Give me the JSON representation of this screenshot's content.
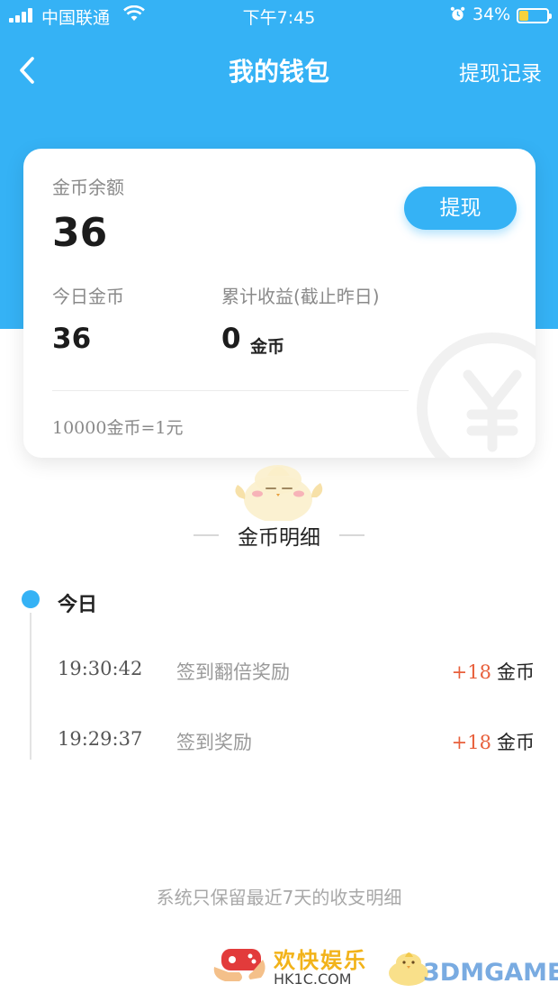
{
  "status_bar": {
    "carrier": "中国联通",
    "time": "下午7:45",
    "battery_percent": "34%",
    "battery_level": 0.34
  },
  "nav": {
    "title": "我的钱包",
    "right_link": "提现记录"
  },
  "balance_card": {
    "balance_label": "金币余额",
    "balance_value": "36",
    "withdraw_button": "提现",
    "today_label": "今日金币",
    "today_value": "36",
    "total_label": "累计收益(截止昨日)",
    "total_value": "0",
    "total_unit": "金币",
    "exchange_rate": "10000金币=1元"
  },
  "details": {
    "section_title": "金币明细",
    "day_label": "今日",
    "rows": [
      {
        "time": "19:30:42",
        "desc": "签到翻倍奖励",
        "amount": "+18",
        "unit": "金币"
      },
      {
        "time": "19:29:37",
        "desc": "签到奖励",
        "amount": "+18",
        "unit": "金币"
      }
    ],
    "footer_note": "系统只保留最近7天的收支明细"
  },
  "watermarks": {
    "site1_name": "欢快娱乐",
    "site1_url": "HK1C.COM",
    "site2_name": "3DMGAME"
  },
  "colors": {
    "primary": "#35b2f5",
    "amount": "#e8603c"
  },
  "icons": {
    "back": "chevron-left-icon",
    "watermark": "yen-coin-icon",
    "mascot": "chick-mascot-icon"
  }
}
